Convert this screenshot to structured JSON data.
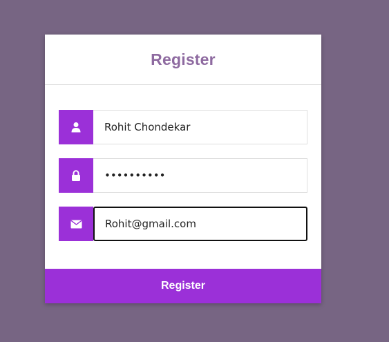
{
  "form": {
    "title": "Register",
    "username": {
      "value": "Rohit Chondekar",
      "icon": "user-icon"
    },
    "password": {
      "value": "••••••••••",
      "icon": "lock-icon"
    },
    "email": {
      "value": "Rohit@gmail.com",
      "icon": "envelope-icon"
    },
    "submit_label": "Register"
  },
  "colors": {
    "page_background": "#776583",
    "accent": "#9b30d8",
    "title": "#8e6aa0"
  }
}
